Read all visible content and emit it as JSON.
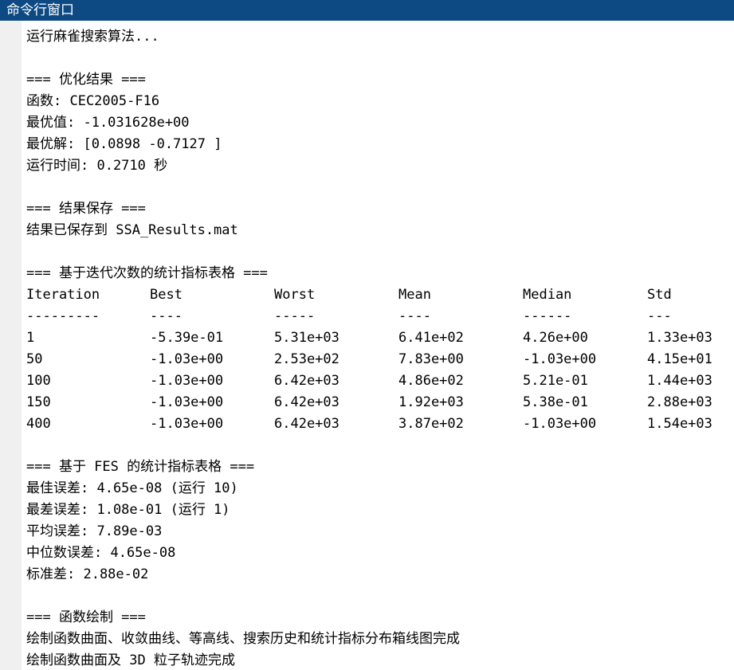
{
  "window": {
    "title": "命令行窗口"
  },
  "run": {
    "start_msg": "运行麻雀搜索算法..."
  },
  "opt": {
    "header": "=== 优化结果 ===",
    "function_line": "函数: CEC2005-F16",
    "best_value_line": "最优值: -1.031628e+00",
    "best_solution_line": "最优解: [0.0898 -0.7127 ]",
    "runtime_line": "运行时间: 0.2710 秒"
  },
  "save": {
    "header": "=== 结果保存 ===",
    "msg": "结果已保存到 SSA_Results.mat"
  },
  "iter_table": {
    "header": "=== 基于迭代次数的统计指标表格 ===",
    "columns": [
      "Iteration",
      "Best",
      "Worst",
      "Mean",
      "Median",
      "Std"
    ],
    "separators": [
      "---------",
      "----",
      "-----",
      "----",
      "------",
      "---"
    ],
    "rows": [
      [
        "1",
        "-5.39e-01",
        "5.31e+03",
        "6.41e+02",
        "4.26e+00",
        "1.33e+03"
      ],
      [
        "50",
        "-1.03e+00",
        "2.53e+02",
        "7.83e+00",
        "-1.03e+00",
        "4.15e+01"
      ],
      [
        "100",
        "-1.03e+00",
        "6.42e+03",
        "4.86e+02",
        "5.21e-01",
        "1.44e+03"
      ],
      [
        "150",
        "-1.03e+00",
        "6.42e+03",
        "1.92e+03",
        "5.38e-01",
        "2.88e+03"
      ],
      [
        "400",
        "-1.03e+00",
        "6.42e+03",
        "3.87e+02",
        "-1.03e+00",
        "1.54e+03"
      ]
    ]
  },
  "fes": {
    "header": "=== 基于 FES 的统计指标表格 ===",
    "best_err_line": "最佳误差: 4.65e-08 (运行 10)",
    "worst_err_line": "最差误差: 1.08e-01 (运行 1)",
    "mean_err_line": "平均误差: 7.89e-03",
    "median_err_line": "中位数误差: 4.65e-08",
    "std_line": "标准差: 2.88e-02"
  },
  "plot": {
    "header": "=== 函数绘制 ===",
    "msg1": "绘制函数曲面、收敛曲线、等高线、搜索历史和统计指标分布箱线图完成",
    "msg2": "绘制函数曲面及 3D 粒子轨迹完成"
  }
}
